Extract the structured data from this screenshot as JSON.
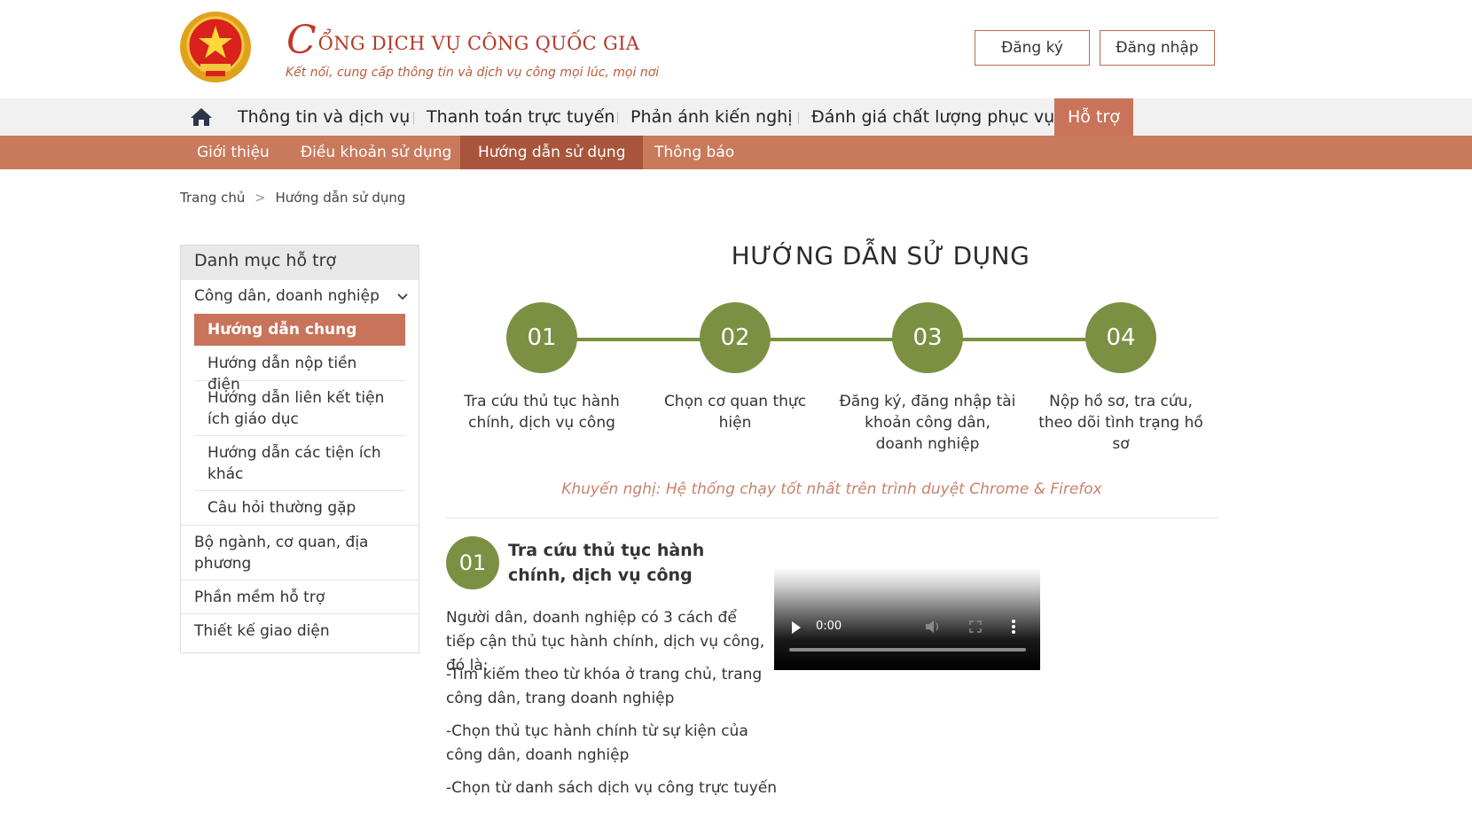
{
  "header": {
    "brand_initial": "C",
    "brand_rest": "ỔNG DỊCH VỤ CÔNG QUỐC GIA",
    "tagline": "Kết nối, cung cấp thông tin và dịch vụ công mọi lúc, mọi nơi",
    "register_label": "Đăng ký",
    "login_label": "Đăng nhập"
  },
  "main_nav": {
    "home_icon": "home-icon",
    "items": [
      "Thông tin và dịch vụ",
      "Thanh toán trực tuyến",
      "Phản ánh kiến nghị",
      "Đánh giá chất lượng phục vụ",
      "Hỗ trợ"
    ],
    "active": "Hỗ trợ"
  },
  "sub_nav": {
    "items": [
      "Giới thiệu",
      "Điều khoản sử dụng",
      "Hướng dẫn sử dụng",
      "Thông báo"
    ],
    "active": "Hướng dẫn sử dụng"
  },
  "breadcrumb": {
    "home": "Trang chủ",
    "separator": ">",
    "current": "Hướng dẫn sử dụng"
  },
  "sidebar": {
    "heading": "Danh mục hỗ trợ",
    "group": "Công dân, doanh nghiệp",
    "sub_items": [
      "Hướng dẫn chung",
      "Hướng dẫn nộp tiền điện",
      "Hướng dẫn liên kết tiện ích giáo dục",
      "Hướng dẫn các tiện ích khác",
      "Câu hỏi thường gặp"
    ],
    "active_sub": "Hướng dẫn chung",
    "items": [
      "Bộ ngành, cơ quan, địa phương",
      "Phần mềm hỗ trợ",
      "Thiết kế giao diện"
    ]
  },
  "content": {
    "title": "HƯỚNG DẪN SỬ DỤNG",
    "steps": [
      {
        "number": "01",
        "text": "Tra cứu thủ tục hành chính, dịch vụ công"
      },
      {
        "number": "02",
        "text": "Chọn cơ quan thực hiện"
      },
      {
        "number": "03",
        "text": "Đăng ký, đăng nhập tài khoản công dân, doanh nghiệp"
      },
      {
        "number": "04",
        "text": "Nộp hồ sơ, tra cứu, theo dõi tình trạng hồ sơ"
      }
    ],
    "recommendation": "Khuyến nghị: Hệ thống chạy tốt nhất trên trình duyệt Chrome & Firefox",
    "section": {
      "number": "01",
      "title": "Tra cứu thủ tục hành chính, dịch vụ công",
      "paragraphs": [
        "Người dân, doanh nghiệp có 3 cách để tiếp cận thủ tục hành chính, dịch vụ công, đó là:",
        "-Tìm kiếm theo từ khóa ở trang chủ, trang công dân, trang doanh nghiệp",
        "-Chọn thủ tục hành chính từ sự kiện của công dân, doanh nghiệp",
        "-Chọn từ danh sách dịch vụ công trực tuyến"
      ]
    },
    "video": {
      "time": "0:00",
      "controls": [
        "play-icon",
        "volume-icon",
        "fullscreen-icon",
        "more-options-icon"
      ]
    }
  },
  "colors": {
    "brand_red": "#b23a2a",
    "accent": "#c8735a",
    "subnav_bg": "#c97a5c",
    "subnav_active": "#a8553b",
    "step_green": "#7c9043",
    "recommend_text": "#c7826a"
  }
}
